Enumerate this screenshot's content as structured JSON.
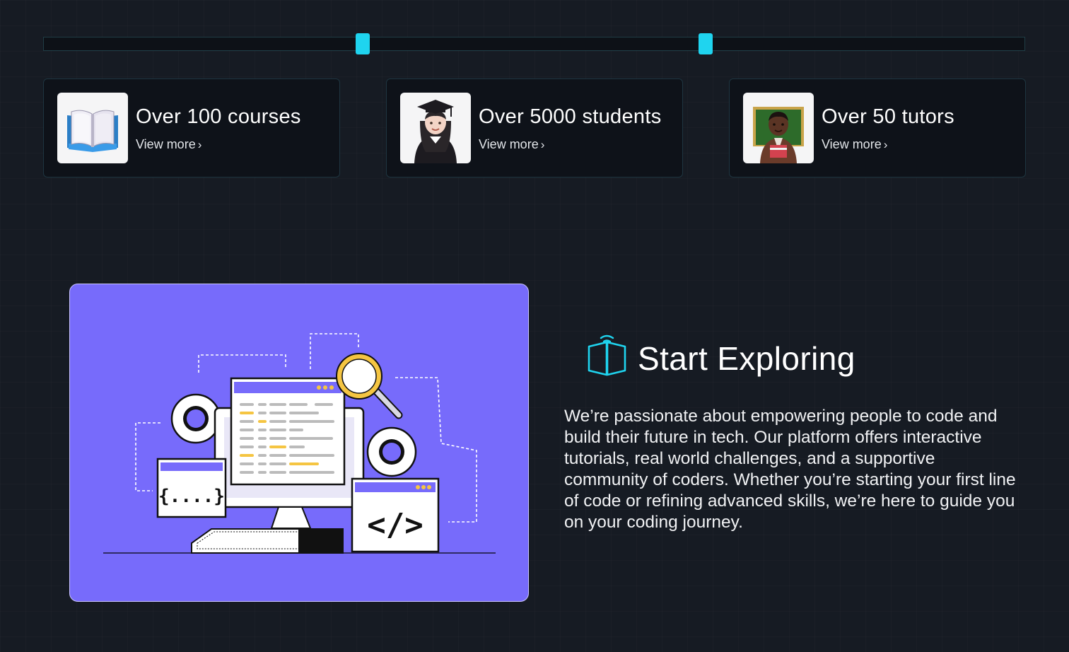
{
  "slider": {
    "handles": [
      {
        "value_fraction": 0.325
      },
      {
        "value_fraction": 0.675
      }
    ]
  },
  "stats": [
    {
      "title": "Over 100 courses",
      "link": "View more",
      "icon": "open-book-icon"
    },
    {
      "title": "Over 5000 students",
      "link": "View more",
      "icon": "graduate-student-icon"
    },
    {
      "title": "Over 50 tutors",
      "link": "View more",
      "icon": "teacher-icon"
    }
  ],
  "chevron": "›",
  "illustration": {
    "name": "coding-illustration",
    "code_symbols": [
      "{....}",
      "</>"
    ],
    "colors": {
      "background": "#776bfb",
      "accent": "#f5c542"
    }
  },
  "explore": {
    "icon": "book-wifi-icon",
    "heading": "Start Exploring",
    "paragraph": "We’re passionate about empowering people to code and build their future in tech. Our platform offers interactive tutorials, real world challenges, and a supportive community of coders. Whether you’re starting your first line of code or refining advanced skills, we’re here to guide you on your coding journey."
  },
  "colors": {
    "page_bg": "#161b23",
    "accent": "#1fd4ef",
    "card_bg": "#0e1219"
  }
}
